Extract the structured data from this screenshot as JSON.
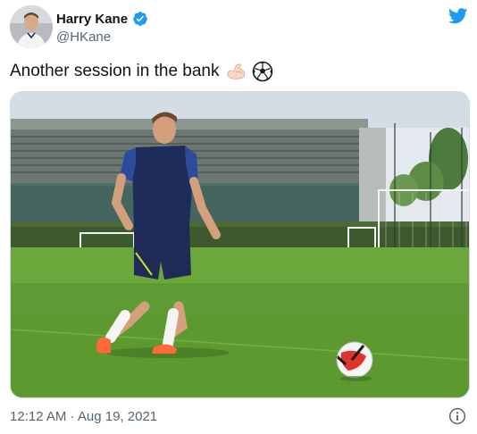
{
  "user": {
    "display_name": "Harry Kane",
    "handle": "@HKane"
  },
  "tweet": {
    "text": "Another session in the bank",
    "emojis": [
      "flexed-biceps-icon",
      "soccer-ball-icon"
    ],
    "timestamp": "12:12 AM · Aug 19, 2021"
  },
  "colors": {
    "twitter_blue": "#1d9bf0",
    "secondary_text": "#536471",
    "border": "#cfd9de"
  }
}
